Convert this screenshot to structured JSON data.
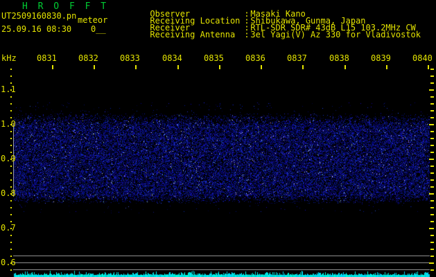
{
  "header": {
    "title": "H R O F F T",
    "filename": "UT2509160830.pn",
    "station_label": "meteor",
    "datetime": "25.09.16 08:30",
    "counter": "0__",
    "colon": ":",
    "info_rows": [
      {
        "label": "Observer",
        "value": "Masaki Kano"
      },
      {
        "label": "Receiving Location",
        "value": "Shibukawa, Gunma, Japan"
      },
      {
        "label": "Receiver",
        "value": "RTL-SDR SDR# 43dB L15 103.2MHz CW"
      },
      {
        "label": "Receiving Antenna",
        "value": "3el Yagi(V) Az 330 for Vladivostok"
      }
    ]
  },
  "axes": {
    "freq_unit_label": "kHz",
    "time_tick_labels": [
      "0831",
      "0832",
      "0833",
      "0834",
      "0835",
      "0836",
      "0837",
      "0838",
      "0839",
      "0840"
    ],
    "freq_tick_labels": [
      "1.1",
      "1.0",
      "0.9",
      "0.8",
      "0.7",
      "0.6"
    ]
  },
  "colors": {
    "background": "#000000",
    "title_green": "#00cd33",
    "text_yellow": "#e3e300",
    "grid_gray": "#8f8f8f",
    "noise_blue": "#2020cc",
    "level_trace_cyan": "#00e0e0"
  },
  "spectrogram": {
    "band_top_khz": 1.0,
    "band_bottom_khz": 0.8,
    "content": "uniform blue background-noise band between 0.8 and 1.0 kHz, no meteor echo traces",
    "bottom_trace": "flat low-level cyan signal-strength trace"
  }
}
